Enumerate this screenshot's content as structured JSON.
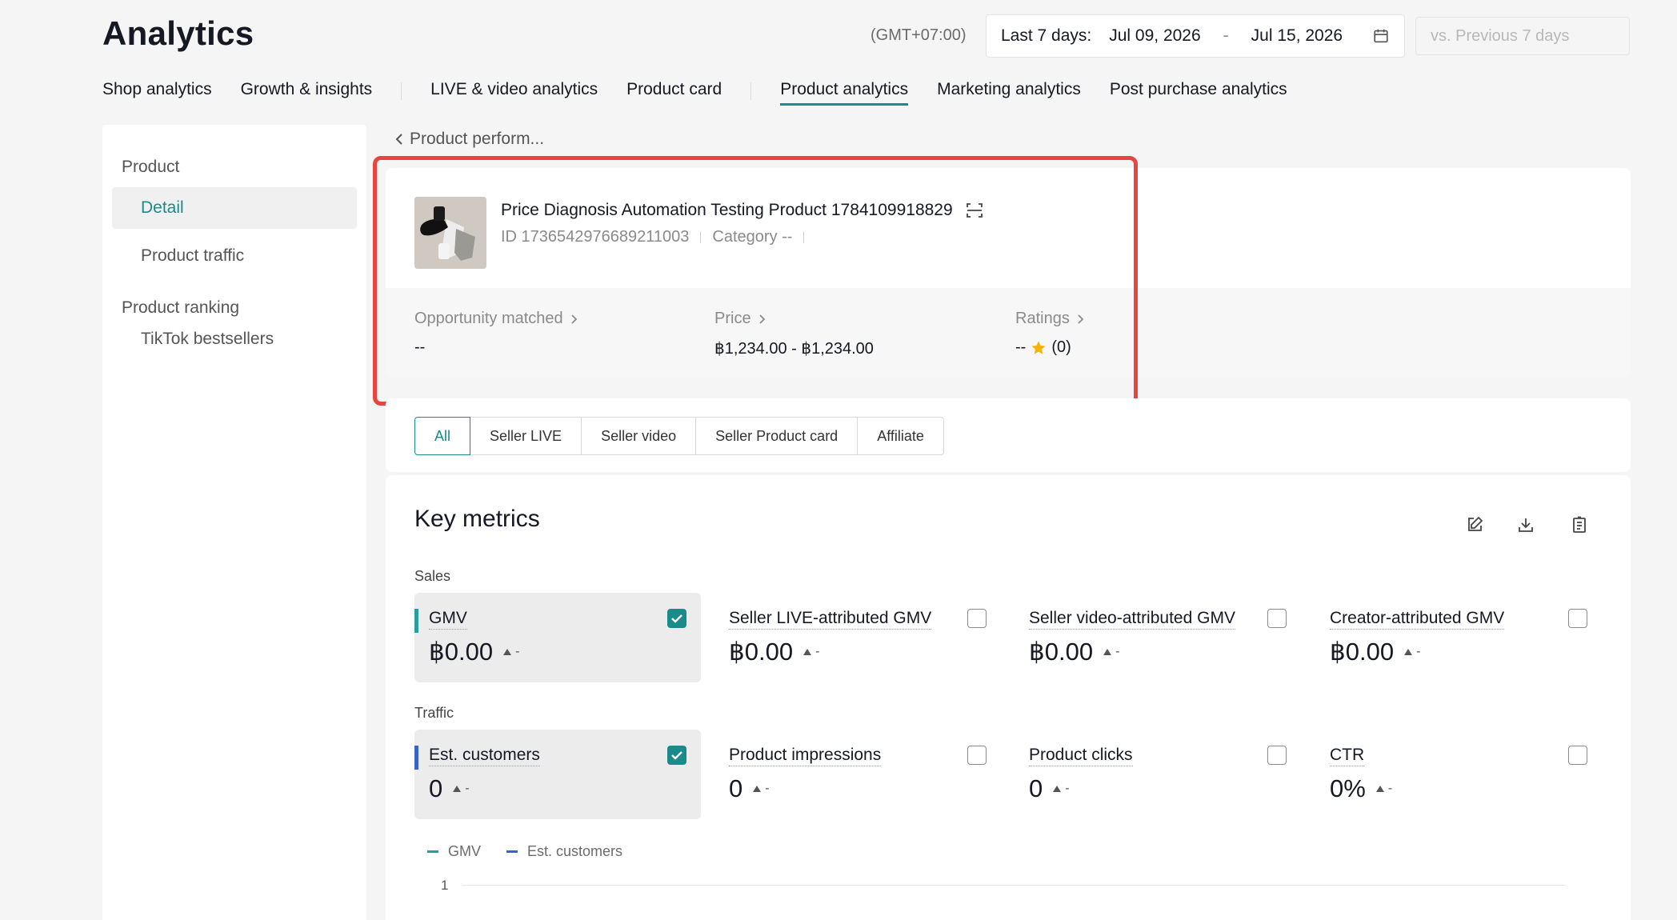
{
  "header": {
    "title": "Analytics",
    "timezone": "(GMT+07:00)",
    "date_range": {
      "label": "Last 7 days:",
      "start": "Jul 09, 2026",
      "separator": "-",
      "end": "Jul 15, 2026"
    },
    "compare_placeholder": "vs. Previous 7 days"
  },
  "tabs": [
    {
      "label": "Shop analytics"
    },
    {
      "label": "Growth & insights"
    },
    {
      "label": "LIVE & video analytics"
    },
    {
      "label": "Product card"
    },
    {
      "label": "Product analytics",
      "active": true
    },
    {
      "label": "Marketing analytics"
    },
    {
      "label": "Post purchase analytics"
    }
  ],
  "sidebar": {
    "group1": "Product",
    "item_detail": "Detail",
    "item_traffic": "Product traffic",
    "group2": "Product ranking",
    "item_bestsellers": "TikTok bestsellers"
  },
  "breadcrumb": {
    "back_label": "Product perform..."
  },
  "product": {
    "name": "Price Diagnosis Automation Testing Product 1784109918829",
    "id_text": "ID 1736542976689211003",
    "category_text": "Category --"
  },
  "product_stats": {
    "opportunity": {
      "label": "Opportunity matched",
      "value": "--"
    },
    "price": {
      "label": "Price",
      "value": "฿1,234.00 - ฿1,234.00"
    },
    "ratings": {
      "label": "Ratings",
      "value": "--",
      "count": "(0)"
    }
  },
  "filters": [
    "All",
    "Seller LIVE",
    "Seller video",
    "Seller Product card",
    "Affiliate"
  ],
  "key_metrics": {
    "title": "Key metrics",
    "sales_label": "Sales",
    "traffic_label": "Traffic",
    "sales": [
      {
        "name": "GMV",
        "value": "฿0.00",
        "trend": "-",
        "checked": true
      },
      {
        "name": "Seller LIVE-attributed GMV",
        "value": "฿0.00",
        "trend": "-",
        "checked": false
      },
      {
        "name": "Seller video-attributed GMV",
        "value": "฿0.00",
        "trend": "-",
        "checked": false
      },
      {
        "name": "Creator-attributed GMV",
        "value": "฿0.00",
        "trend": "-",
        "checked": false
      }
    ],
    "traffic": [
      {
        "name": "Est. customers",
        "value": "0",
        "trend": "-",
        "checked": true
      },
      {
        "name": "Product impressions",
        "value": "0",
        "trend": "-",
        "checked": false
      },
      {
        "name": "Product clicks",
        "value": "0",
        "trend": "-",
        "checked": false
      },
      {
        "name": "CTR",
        "value": "0%",
        "trend": "-",
        "checked": false
      }
    ]
  },
  "chart": {
    "legend": [
      {
        "name": "GMV",
        "color": "#2a9d9d"
      },
      {
        "name": "Est. customers",
        "color": "#3a63c7"
      }
    ],
    "y_tick": "1"
  },
  "colors": {
    "accent": "#1a8a8a",
    "highlight": "#ea4440",
    "star": "#f5b400"
  }
}
